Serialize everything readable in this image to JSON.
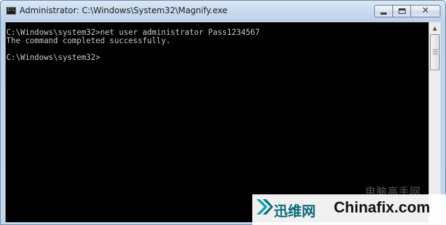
{
  "window": {
    "title": "Administrator: C:\\Windows\\System32\\Magnify.exe",
    "icon_text": "C:\\",
    "buttons": {
      "minimize": "minimize-icon",
      "maximize": "maximize-icon",
      "close": "close-icon",
      "close_glyph": "✕"
    }
  },
  "console": {
    "lines": [
      "C:\\Windows\\system32>net user administrator Pass1234567",
      "The command completed successfully.",
      "",
      "C:\\Windows\\system32>"
    ],
    "text_color": "#c8c8c8",
    "background": "#000000"
  },
  "scrollbar": {
    "up_arrow": "▲"
  },
  "watermark": {
    "caption": "电脑高手网",
    "brand_cn": "迅维网",
    "brand_en": "Chinafix.com",
    "accent_color": "#14a3a8"
  }
}
